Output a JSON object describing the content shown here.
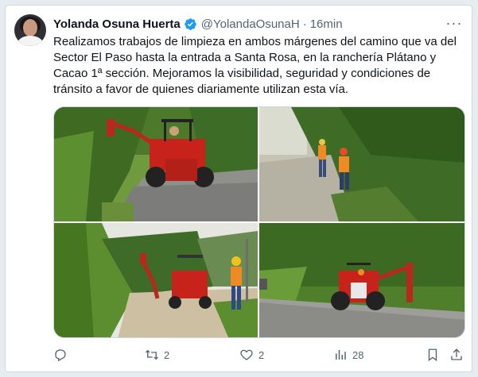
{
  "tweet": {
    "author_name": "Yolanda Osuna Huerta",
    "handle": "@YolandaOsunaH",
    "separator": "·",
    "time": "16min",
    "text": "Realizamos trabajos de limpieza en ambos márgenes del camino que va del Sector El Paso hasta la entrada a Santa Rosa, en la ranchería Plátano y Cacao 1ª sección. Mejoramos la visibilidad, seguridad y condiciones de tránsito a favor de quienes diariamente utilizan esta vía.",
    "more_label": "···"
  },
  "photos": [
    {
      "name": "photo-tractor-mowing-roadside"
    },
    {
      "name": "photo-workers-clearing-brush"
    },
    {
      "name": "photo-worker-beside-tractor"
    },
    {
      "name": "photo-tractor-with-arm-on-road"
    }
  ],
  "actions": {
    "reply": {
      "icon": "reply-icon",
      "count": ""
    },
    "retweet": {
      "icon": "retweet-icon",
      "count": "2"
    },
    "like": {
      "icon": "heart-icon",
      "count": "2"
    },
    "views": {
      "icon": "analytics-icon",
      "count": "28"
    },
    "bookmark": {
      "icon": "bookmark-icon",
      "count": ""
    },
    "share": {
      "icon": "share-icon",
      "count": ""
    }
  },
  "colors": {
    "verified": "#1d9bf0",
    "muted": "#536471",
    "tractor_red": "#c8231b"
  }
}
